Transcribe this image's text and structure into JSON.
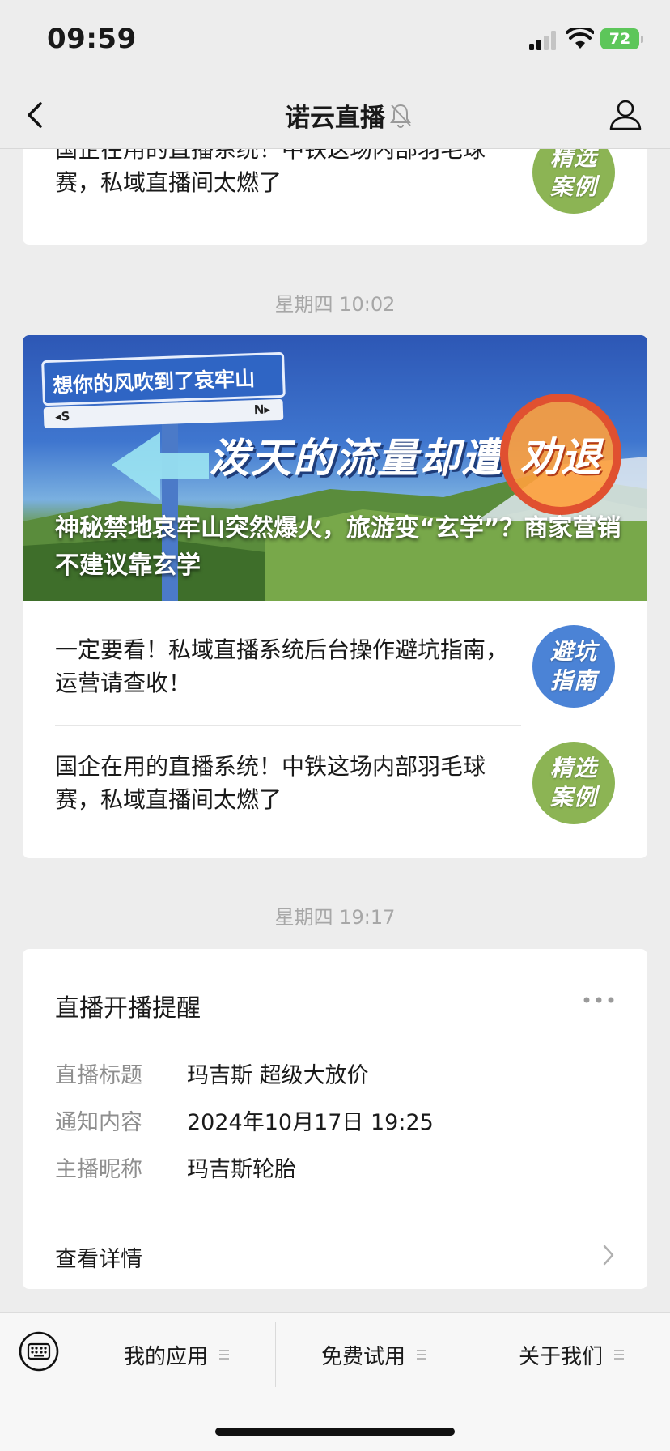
{
  "status_bar": {
    "time": "09:59",
    "battery": "72"
  },
  "nav": {
    "title": "诺云直播"
  },
  "top_card": {
    "text": "国企在用的直播系统！中铁这场内部羽毛球赛，私域直播间太燃了",
    "thumb": {
      "line1": "精选",
      "line2": "案例",
      "color": "#8cb454"
    }
  },
  "timestamps": [
    "星期四 10:02",
    "星期四 19:17"
  ],
  "news_card": {
    "cover": {
      "sign_text": "想你的风吹到了哀牢山",
      "sign_s": "◂S",
      "sign_n": "N▸",
      "headline": "泼天的流量却遭",
      "stamp": "劝退",
      "caption": "神秘禁地哀牢山突然爆火，旅游变“玄学”？商家营销不建议靠玄学"
    },
    "items": [
      {
        "text": "一定要看！私域直播系统后台操作避坑指南，运营请查收！",
        "thumb_line1": "避坑",
        "thumb_line2": "指南",
        "thumb_color": "#4b83d6"
      },
      {
        "text": "国企在用的直播系统！中铁这场内部羽毛球赛，私域直播间太燃了",
        "thumb_line1": "精选",
        "thumb_line2": "案例",
        "thumb_color": "#8cb454"
      }
    ]
  },
  "live_card": {
    "title": "直播开播提醒",
    "fields": [
      {
        "label": "直播标题",
        "value": "玛吉斯 超级大放价"
      },
      {
        "label": "通知内容",
        "value": "2024年10月17日 19:25"
      },
      {
        "label": "主播昵称",
        "value": "玛吉斯轮胎"
      }
    ],
    "detail_label": "查看详情"
  },
  "bottom_menu": {
    "items": [
      "我的应用",
      "免费试用",
      "关于我们"
    ]
  }
}
